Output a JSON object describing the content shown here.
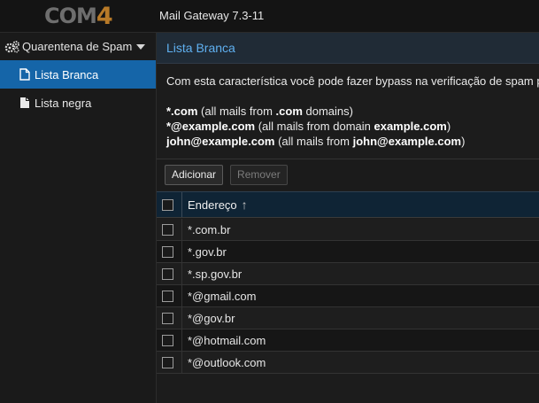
{
  "header": {
    "logo_main": "COM",
    "logo_digit": "4",
    "app_title": "Mail Gateway 7.3-11"
  },
  "sidebar": {
    "group_label": "Quarentena de Spam",
    "items": [
      {
        "label": "Lista Branca",
        "active": true
      },
      {
        "label": "Lista negra",
        "active": false
      }
    ]
  },
  "panel": {
    "title": "Lista Branca",
    "description": "Com esta característica você pode fazer bypass na verificação de spam p",
    "examples": [
      {
        "bold": "*.com",
        "rest1": " (all mails from ",
        "bold2": ".com",
        "rest2": " domains)"
      },
      {
        "bold": "*@example.com",
        "rest1": " (all mails from domain ",
        "bold2": "example.com",
        "rest2": ")"
      },
      {
        "bold": "john@example.com",
        "rest1": " (all mails from ",
        "bold2": "john@example.com",
        "rest2": ")"
      }
    ]
  },
  "toolbar": {
    "add_label": "Adicionar",
    "remove_label": "Remover"
  },
  "grid": {
    "column_header": "Endereço",
    "sort_arrow": "↑",
    "rows": [
      "*.com.br",
      "*.gov.br",
      "*.sp.gov.br",
      "*@gmail.com",
      "*@gov.br",
      "*@hotmail.com",
      "*@outlook.com"
    ]
  },
  "colors": {
    "accent": "#1565a8",
    "title_blue": "#5fb0f0",
    "logo_orange": "#b87a28"
  },
  "icons": {
    "group": "settings-cogs-icon",
    "item": "document-icon",
    "caret": "caret-down-icon"
  }
}
